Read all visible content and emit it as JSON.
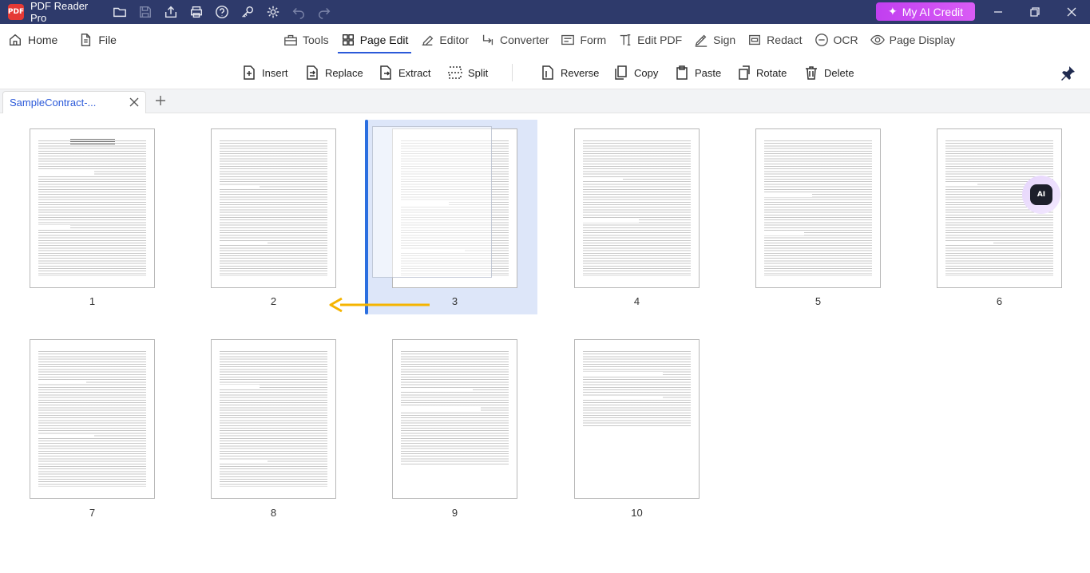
{
  "app": {
    "name": "PDF Reader Pro",
    "logo_text": "PDF"
  },
  "titlebar": {
    "icons": [
      "open-folder-icon",
      "save-icon",
      "share-icon",
      "print-icon",
      "help-icon",
      "key-icon",
      "settings-icon",
      "undo-icon",
      "redo-icon"
    ],
    "ai_credit_label": "My AI Credit"
  },
  "menu": {
    "home_label": "Home",
    "file_label": "File",
    "tabs": [
      {
        "label": "Tools",
        "icon": "toolbox-icon"
      },
      {
        "label": "Page Edit",
        "icon": "grid-icon"
      },
      {
        "label": "Editor",
        "icon": "edit-icon"
      },
      {
        "label": "Converter",
        "icon": "convert-icon"
      },
      {
        "label": "Form",
        "icon": "form-icon"
      },
      {
        "label": "Edit PDF",
        "icon": "text-edit-icon"
      },
      {
        "label": "Sign",
        "icon": "sign-icon"
      },
      {
        "label": "Redact",
        "icon": "redact-icon"
      },
      {
        "label": "OCR",
        "icon": "ocr-icon"
      },
      {
        "label": "Page Display",
        "icon": "eye-icon"
      }
    ],
    "active_tab": "Page Edit"
  },
  "toolbar": {
    "insert": "Insert",
    "replace": "Replace",
    "extract": "Extract",
    "split": "Split",
    "reverse": "Reverse",
    "copy": "Copy",
    "paste": "Paste",
    "rotate": "Rotate",
    "delete": "Delete"
  },
  "tabs": {
    "document_tab": "SampleContract-..."
  },
  "pages": {
    "numbers": [
      "1",
      "2",
      "3",
      "4",
      "5",
      "6",
      "7",
      "8",
      "9",
      "10"
    ]
  },
  "colors": {
    "titlebar": "#2e3a6b",
    "accent": "#2b59d9",
    "ai_credit": "#c13ff0",
    "drop_indicator": "#2b6fe0",
    "drag_arrow": "#f5b400"
  }
}
